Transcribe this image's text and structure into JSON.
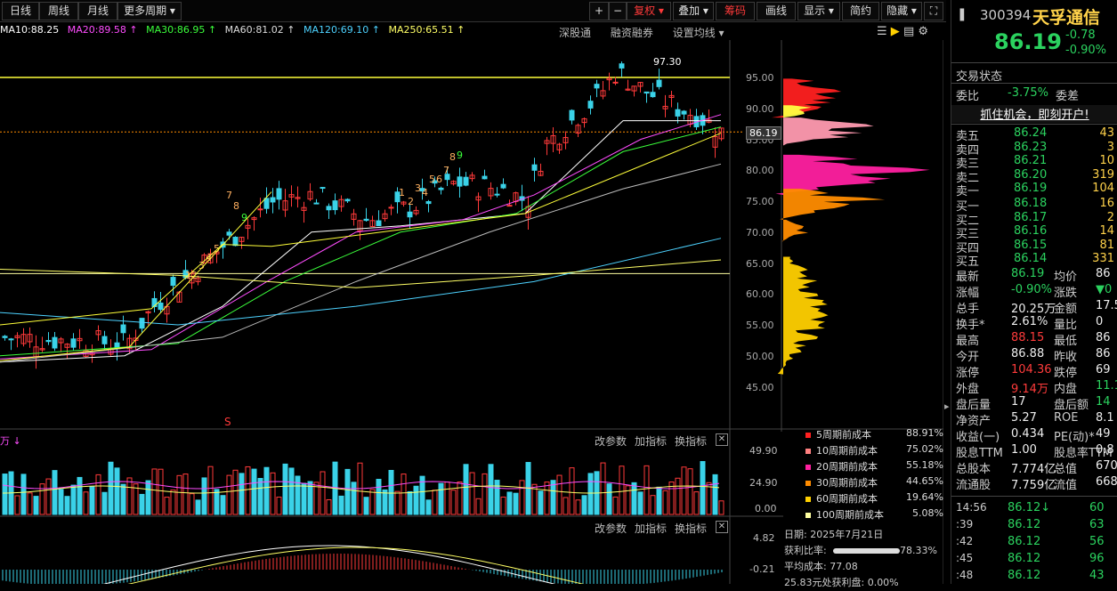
{
  "toolbar": {
    "periods": [
      "日线",
      "周线",
      "月线",
      "更多周期 ▾"
    ],
    "buttons": [
      "+",
      "−",
      "复权 ▾",
      "叠加 ▾",
      "筹码",
      "画线",
      "显示 ▾",
      "简约",
      "隐藏 ▾",
      "⛶"
    ]
  },
  "ma_labels": [
    {
      "text": "MA10:88.25",
      "color": "#ffffff"
    },
    {
      "text": "MA20:89.58 ↑",
      "color": "#ff4dff"
    },
    {
      "text": "MA30:86.95 ↑",
      "color": "#3bff3b"
    },
    {
      "text": "MA60:81.02 ↑",
      "color": "#dddddd"
    },
    {
      "text": "MA120:69.10 ↑",
      "color": "#4dd2ff"
    },
    {
      "text": "MA250:65.51 ↑",
      "color": "#ffff66"
    }
  ],
  "subtools": [
    "深股通",
    "融资融券",
    "设置均线 ▾"
  ],
  "price_axis": [
    "95.00",
    "90.00",
    "85.00",
    "80.00",
    "75.00",
    "70.00",
    "65.00",
    "60.00",
    "55.00",
    "50.00",
    "45.00"
  ],
  "current_price_tag": "86.19",
  "high_annotation": "97.30",
  "vol_axis": [
    "49.90",
    "24.90",
    "0.00"
  ],
  "macd_axis": [
    "4.82",
    "-0.21"
  ],
  "vol_head": {
    "unit": "万 ↓",
    "links": [
      "改参数",
      "加指标",
      "换指标"
    ]
  },
  "macd_head": {
    "links": [
      "改参数",
      "加指标",
      "换指标"
    ]
  },
  "chip_legend": [
    {
      "label": "5周期前成本",
      "pct": "88.91%",
      "color": "#ff2020"
    },
    {
      "label": "10周期前成本",
      "pct": "75.02%",
      "color": "#ff8080"
    },
    {
      "label": "20周期前成本",
      "pct": "55.18%",
      "color": "#ff20a0"
    },
    {
      "label": "30周期前成本",
      "pct": "44.65%",
      "color": "#ff8c00"
    },
    {
      "label": "60周期前成本",
      "pct": "19.64%",
      "color": "#ffd000"
    },
    {
      "label": "100周期前成本",
      "pct": "5.08%",
      "color": "#ffffa0"
    }
  ],
  "chip_info": {
    "date": "日期: 2025年7月21日",
    "profit_label": "获利比率:",
    "profit": "78.33%",
    "avg_cost": "平均成本: 77.08",
    "extra": "25.83元处获利盘: 0.00%"
  },
  "quote": {
    "code": "300394",
    "name": "天孚通信",
    "price": "86.19",
    "change": "-0.78",
    "pct": "-0.90%",
    "status": "交易状态",
    "weibi_label": "委比",
    "weibi": "-3.75%",
    "weicha": "委差",
    "promo": "抓住机会，即刻开户!",
    "asks": [
      [
        "卖五",
        "86.24",
        "43"
      ],
      [
        "卖四",
        "86.23",
        "3"
      ],
      [
        "卖三",
        "86.21",
        "10"
      ],
      [
        "卖二",
        "86.20",
        "319"
      ],
      [
        "卖一",
        "86.19",
        "104"
      ]
    ],
    "bids": [
      [
        "买一",
        "86.18",
        "16"
      ],
      [
        "买二",
        "86.17",
        "2"
      ],
      [
        "买三",
        "86.16",
        "14"
      ],
      [
        "买四",
        "86.15",
        "81"
      ],
      [
        "买五",
        "86.14",
        "331"
      ]
    ],
    "stats": [
      [
        "最新",
        "86.19",
        "均价",
        "86"
      ],
      [
        "涨幅",
        "-0.90%",
        "涨跌",
        "▼0"
      ],
      [
        "总手",
        "20.25万",
        "金额",
        "17.5"
      ],
      [
        "换手*",
        "2.61%",
        "量比",
        "0"
      ],
      [
        "最高",
        "88.15",
        "最低",
        "86"
      ],
      [
        "今开",
        "86.88",
        "昨收",
        "86"
      ],
      [
        "涨停",
        "104.36",
        "跌停",
        "69"
      ],
      [
        "外盘",
        "9.14万",
        "内盘",
        "11.1"
      ],
      [
        "盘后量",
        "17",
        "盘后额",
        "14"
      ],
      [
        "净资产",
        "5.27",
        "ROE",
        "8.1"
      ],
      [
        "收益(一)",
        "0.434",
        "PE(动)*",
        "49"
      ],
      [
        "股息TTM",
        "1.00",
        "股息率TTM",
        "0.8"
      ],
      [
        "总股本",
        "7.774亿",
        "总值",
        "670."
      ],
      [
        "流通股",
        "7.759亿",
        "流值",
        "668."
      ]
    ],
    "ticks": [
      [
        "14:56",
        "86.12↓",
        "60"
      ],
      [
        ":39",
        "86.12",
        "63"
      ],
      [
        ":42",
        "86.12",
        "56"
      ],
      [
        ":45",
        "86.12",
        "96"
      ],
      [
        ":48",
        "86.12",
        "43"
      ]
    ]
  }
}
